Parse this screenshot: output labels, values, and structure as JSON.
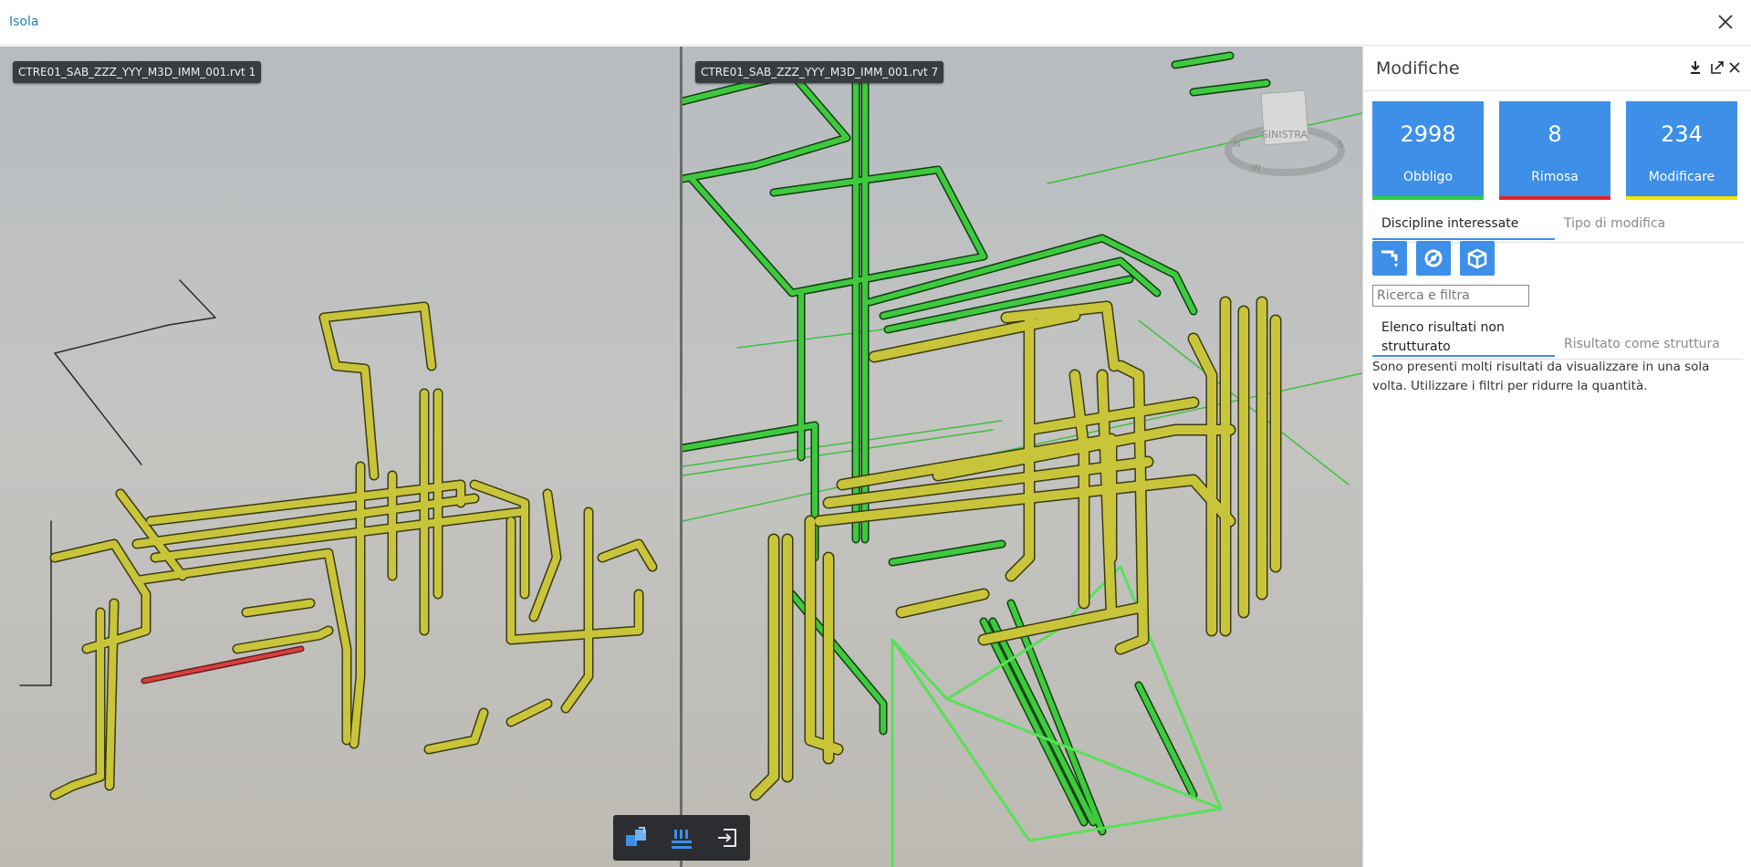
{
  "window": {
    "title": "Isola"
  },
  "viewports": {
    "left": {
      "label": "CTRE01_SAB_ZZZ_YYY_M3D_IMM_001.rvt 1"
    },
    "right": {
      "label": "CTRE01_SAB_ZZZ_YYY_M3D_IMM_001.rvt 7"
    }
  },
  "navcube": {
    "face": "SINISTRA",
    "compass": [
      "N",
      "S",
      "W"
    ]
  },
  "toolbar": {
    "buttons": [
      "compare-icon",
      "list-icon",
      "exit-icon"
    ]
  },
  "panel": {
    "title": "Modifiche",
    "summary": [
      {
        "count": "2998",
        "label": "Obbligo",
        "color": "#2ecc40"
      },
      {
        "count": "8",
        "label": "Rimosa",
        "color": "#e02424"
      },
      {
        "count": "234",
        "label": "Modificare",
        "color": "#f2e600"
      }
    ],
    "tabs": {
      "active": "Discipline interessate",
      "inactive": "Tipo di modifica"
    },
    "discipline_icons": [
      "plumbing-icon",
      "mechanical-icon",
      "structure-icon"
    ],
    "search": {
      "placeholder": "Ricerca e filtra"
    },
    "result_tabs": {
      "active": "Elenco risultati non strutturato",
      "inactive": "Risultato come struttura"
    },
    "message": "Sono presenti molti risultati da visualizzare in una sola volta. Utilizzare i filtri per ridurre la quantità."
  }
}
